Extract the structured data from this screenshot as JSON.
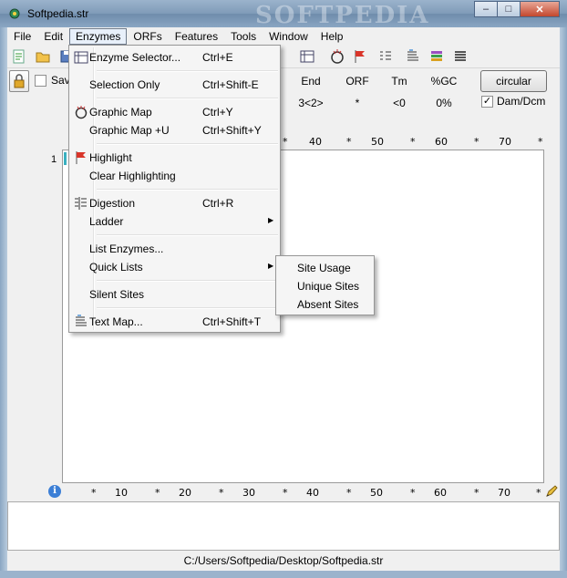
{
  "window": {
    "title": "Softpedia.str",
    "watermark": "SOFTPEDIA",
    "minimize": "–",
    "maximize": "□",
    "close": "✕"
  },
  "menubar": [
    "File",
    "Edit",
    "Enzymes",
    "ORFs",
    "Features",
    "Tools",
    "Window",
    "Help"
  ],
  "info": {
    "save_label": "Sav",
    "columns": [
      {
        "head": "End",
        "value": "3<2>"
      },
      {
        "head": "ORF",
        "value": "*"
      },
      {
        "head": "Tm",
        "value": "<0"
      },
      {
        "head": "%GC",
        "value": "0%"
      }
    ],
    "topology_button": "circular",
    "dam_label": "Dam/Dcm",
    "dam_checked": "✓"
  },
  "ruler": {
    "top": [
      "*",
      "40",
      "*",
      "50",
      "*",
      "60",
      "*",
      "70",
      "*"
    ],
    "bottom": [
      "*",
      "10",
      "*",
      "20",
      "*",
      "30",
      "*",
      "40",
      "*",
      "50",
      "*",
      "60",
      "*",
      "70",
      "*"
    ]
  },
  "sequence": {
    "line_number": "1"
  },
  "dropdown": {
    "items": [
      {
        "label": "Enzyme Selector...",
        "shortcut": "Ctrl+E",
        "icon": "enzyme-selector-icon"
      },
      {
        "label": "Selection Only",
        "shortcut": "Ctrl+Shift-E"
      },
      {
        "label": "Graphic Map",
        "shortcut": "Ctrl+Y",
        "icon": "graphic-map-icon"
      },
      {
        "label": "Graphic Map +U",
        "shortcut": "Ctrl+Shift+Y"
      },
      {
        "label": "Highlight",
        "shortcut": "",
        "icon": "highlight-flag-icon"
      },
      {
        "label": "Clear Highlighting",
        "shortcut": ""
      },
      {
        "label": "Digestion",
        "shortcut": "Ctrl+R",
        "icon": "digestion-icon"
      },
      {
        "label": "Ladder",
        "shortcut": "",
        "submenu": "▶"
      },
      {
        "label": "List Enzymes...",
        "shortcut": ""
      },
      {
        "label": "Quick Lists",
        "shortcut": "",
        "submenu": "▶"
      },
      {
        "label": "Silent Sites",
        "shortcut": ""
      },
      {
        "label": "Text Map...",
        "shortcut": "Ctrl+Shift+T",
        "icon": "text-map-icon"
      }
    ]
  },
  "submenu": {
    "items": [
      "Site Usage",
      "Unique Sites",
      "Absent Sites"
    ]
  },
  "status": {
    "path": "C:/Users/Softpedia/Desktop/Softpedia.str"
  },
  "colors": {
    "accent": "#3c7fd6",
    "flag": "#d9352a",
    "cursor": "#3ab0c0"
  }
}
